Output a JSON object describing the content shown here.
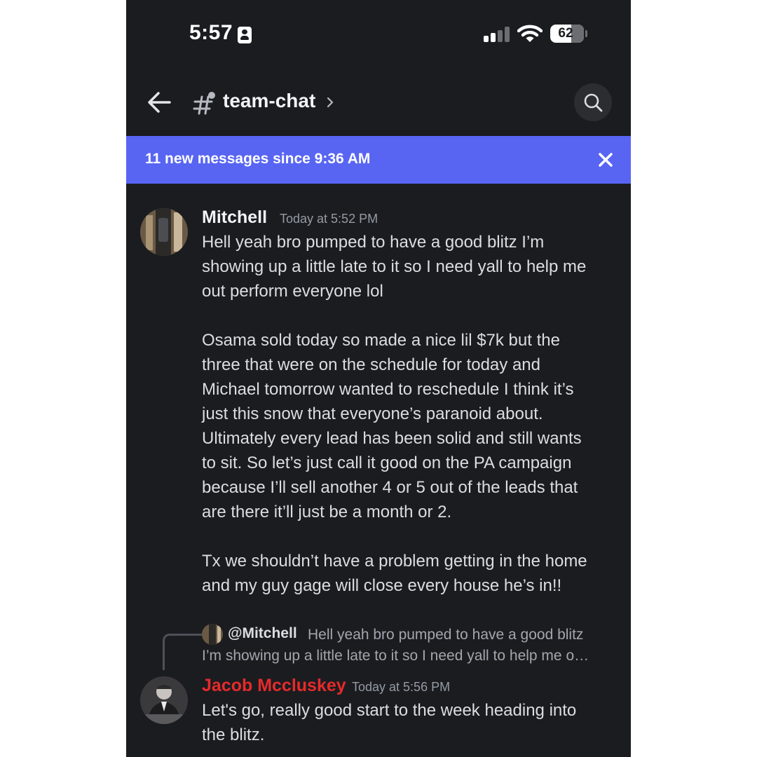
{
  "status_bar": {
    "time": "5:57",
    "battery": "62",
    "battery_level": 0.62,
    "icons": [
      "id-card-icon",
      "signal-icon",
      "wifi-icon",
      "battery-icon"
    ]
  },
  "header": {
    "channel_name": "team-chat",
    "icons": [
      "back-arrow-icon",
      "hashtag-icon",
      "chevron-right-icon",
      "search-icon"
    ]
  },
  "banner": {
    "text": "11 new messages since 9:36 AM",
    "color": "#5865f2",
    "icons": [
      "close-icon"
    ]
  },
  "messages": [
    {
      "author": "Mitchell",
      "author_color": "#f2f3f5",
      "timestamp": "Today at 5:52 PM",
      "body": "Hell yeah bro pumped to have a good blitz I’m\nshowing up a little late to it so I need yall to help me\nout perform everyone lol\n\nOsama sold today so made a nice lil $7k but the\nthree that were on the schedule for today and\nMichael tomorrow wanted to reschedule I think it’s\njust this snow that everyone’s paranoid about.\nUltimately every lead has been solid and still wants\nto sit. So let’s just call it good on the PA campaign\nbecause I’ll sell another 4 or 5 out of the leads that\nare there it’ll just be a month or 2.\n\nTx we shouldn’t have a problem getting in the home\nand my guy gage will close every house he’s in!!"
    },
    {
      "reply": {
        "author": "@Mitchell",
        "preview_line1": "Hell yeah bro pumped to have a good blitz",
        "preview_line2": "I’m showing up a little late to it so I need yall to help me o…"
      },
      "author": "Jacob Mccluskey",
      "author_color": "#e62a2a",
      "timestamp": "Today at 5:56 PM",
      "body": "Let's go, really good start to the week heading into\nthe blitz."
    }
  ]
}
